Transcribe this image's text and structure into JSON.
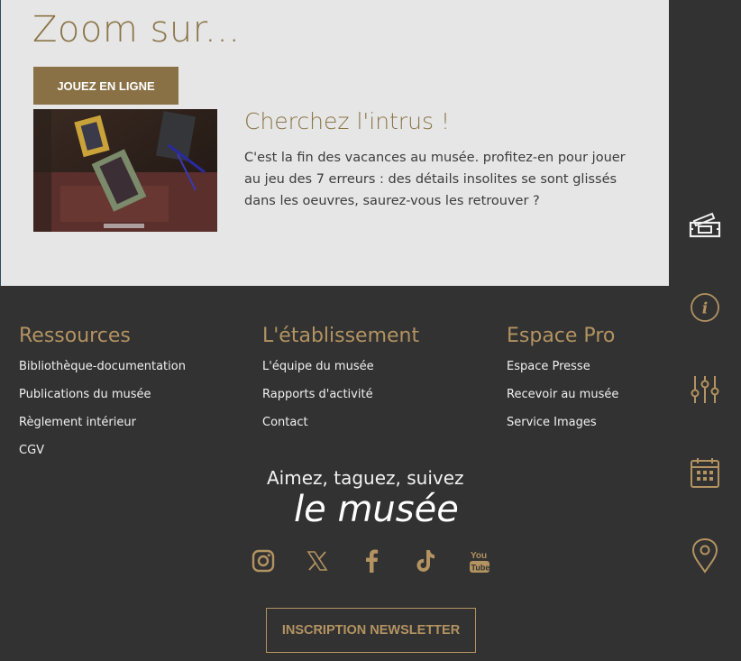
{
  "zoom": {
    "title": "Zoom sur...",
    "play_button": "JOUEZ EN LIGNE",
    "article": {
      "title": "Cherchez l'intrus !",
      "text": "C'est la fin des vacances au musée. profitez-en pour jouer au jeu des 7 erreurs : des détails insolites se sont glissés dans les oeuvres, saurez-vous les retrouver ?"
    }
  },
  "footer": {
    "columns": [
      {
        "title": "Ressources",
        "links": [
          "Bibliothèque-documentation",
          "Publications du musée",
          "Règlement intérieur",
          "CGV"
        ]
      },
      {
        "title": "L'établissement",
        "links": [
          "L'équipe du musée",
          "Rapports d'activité",
          "Contact"
        ]
      },
      {
        "title": "Espace Pro",
        "links": [
          "Espace Presse",
          "Recevoir au musée",
          "Service Images"
        ]
      }
    ],
    "social_tagline": "Aimez, taguez, suivez",
    "social_name": "le musée",
    "social_icons": [
      "instagram-icon",
      "x-icon",
      "facebook-icon",
      "tiktok-icon",
      "youtube-icon"
    ],
    "newsletter_button": "INSCRIPTION NEWSLETTER"
  },
  "sidebar": {
    "icons": [
      "ticket-icon",
      "info-icon",
      "settings-sliders-icon",
      "calendar-icon",
      "location-pin-icon"
    ]
  },
  "colors": {
    "accent": "#8a7145",
    "gold_text": "#b39361",
    "footer_bg": "#323232",
    "zoom_bg": "#e6e6e6"
  }
}
